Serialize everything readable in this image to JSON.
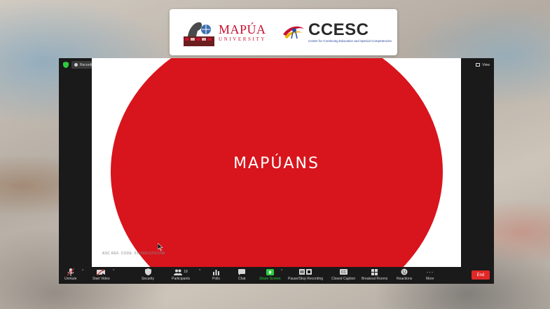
{
  "banner": {
    "mapua_name": "MAPÚA",
    "mapua_sub": "UNIVERSITY",
    "ccesc_name": "CCESC",
    "ccesc_sub": "Center for Continuing Education and Special Competencies"
  },
  "slide": {
    "title": "MAPÚANS",
    "ref_code": "ASC REF. CODE: 0119MOS2021NB",
    "circle_color": "#d8141c"
  },
  "recording": {
    "label": "Recording..."
  },
  "view": {
    "label": "View"
  },
  "toolbar": {
    "unmute": "Unmute",
    "start_video": "Start Video",
    "security": "Security",
    "participants": "Participants",
    "participants_count": "18",
    "polls": "Polls",
    "chat": "Chat",
    "share_screen": "Share Screen",
    "pause_recording": "Pause/Stop Recording",
    "closed_caption": "Closed Caption",
    "breakout_rooms": "Breakout Rooms",
    "reactions": "Reactions",
    "more": "More",
    "end": "End"
  },
  "colors": {
    "accent_red": "#e02828",
    "share_green": "#2ecc40",
    "brand_red": "#c8102e"
  }
}
